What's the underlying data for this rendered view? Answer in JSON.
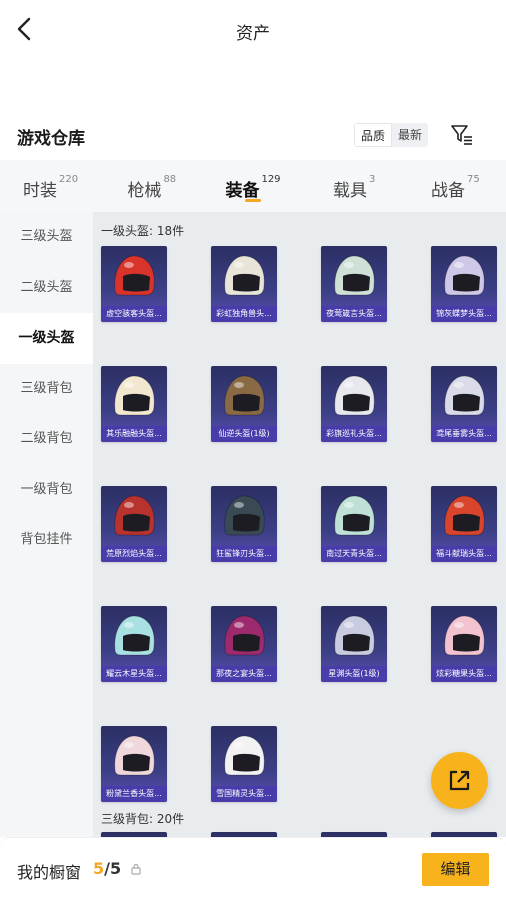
{
  "header": {
    "title": "资产"
  },
  "warehouse": {
    "title": "游戏仓库",
    "sort_options": [
      "品质",
      "最新"
    ],
    "active_sort": 0
  },
  "tabs": [
    {
      "label": "时装",
      "count": "220"
    },
    {
      "label": "枪械",
      "count": "88"
    },
    {
      "label": "装备",
      "count": "129"
    },
    {
      "label": "载具",
      "count": "3"
    },
    {
      "label": "战备",
      "count": "75"
    }
  ],
  "active_tab": 2,
  "sidebar": {
    "items": [
      {
        "label": "三级头盔"
      },
      {
        "label": "二级头盔"
      },
      {
        "label": "一级头盔"
      },
      {
        "label": "三级背包"
      },
      {
        "label": "二级背包"
      },
      {
        "label": "一级背包"
      },
      {
        "label": "背包挂件"
      }
    ],
    "active_index": 2
  },
  "sections": [
    {
      "title": "一级头盔: 18件",
      "items": [
        {
          "label": "虚空骇客头盔...",
          "color": "#d9342b"
        },
        {
          "label": "彩虹独角兽头...",
          "color": "#e8e4d8"
        },
        {
          "label": "夜莺箴言头盔...",
          "color": "#cfe1d6"
        },
        {
          "label": "锦灰蝶梦头盔...",
          "color": "#cfc7e8"
        },
        {
          "label": "其乐融融头盔...",
          "color": "#f2e7cf"
        },
        {
          "label": "仙逆头盔(1级)",
          "color": "#8a6a45"
        },
        {
          "label": "彩旗巡礼头盔...",
          "color": "#e7e7ee"
        },
        {
          "label": "鸢尾垂雾头盔...",
          "color": "#d9dbe8"
        },
        {
          "label": "荒原烈焰头盔...",
          "color": "#b8322e"
        },
        {
          "label": "狂鲨锋刃头盔...",
          "color": "#3a4a55"
        },
        {
          "label": "南过天青头盔...",
          "color": "#bfe0d6"
        },
        {
          "label": "福斗献瑞头盔...",
          "color": "#d8442c"
        },
        {
          "label": "耀云木星头盔...",
          "color": "#a9e0e2"
        },
        {
          "label": "那夜之宴头盔...",
          "color": "#9c2a6c"
        },
        {
          "label": "星渊头盔(1级)",
          "color": "#c9cbe0"
        },
        {
          "label": "炫彩糖果头盔...",
          "color": "#f2c2cf"
        },
        {
          "label": "粉黛兰香头盔...",
          "color": "#efd7dc"
        },
        {
          "label": "雪国精灵头盔...",
          "color": "#f2f2f2"
        }
      ]
    },
    {
      "title": "三级背包: 20件",
      "items": []
    }
  ],
  "bottom": {
    "label": "我的橱窗",
    "current": "5",
    "sep": "/",
    "total": "5",
    "edit_label": "编辑"
  },
  "colors": {
    "accent": "#f7b21c",
    "cell_bg": "#3c3f86",
    "label_bg": "#463caa"
  }
}
